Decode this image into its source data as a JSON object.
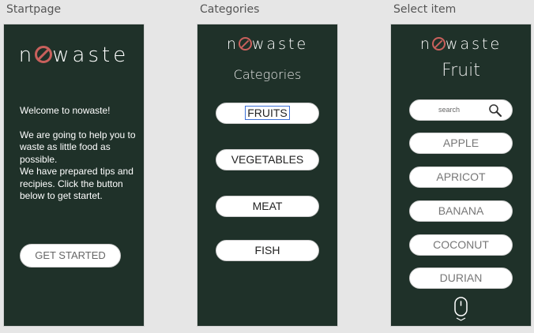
{
  "frames": {
    "start": {
      "label": "Startpage",
      "logo": {
        "pre": "n",
        "post": "waste"
      },
      "welcome_line": "Welcome to nowaste!",
      "help_text": "We are going to help you to waste as little food as possible.",
      "prepared_text": "We have prepared tips and recipies. Click the button below to get startet.",
      "get_started_label": "GET STARTED"
    },
    "categories": {
      "label": "Categories",
      "logo": {
        "pre": "n",
        "post": "waste"
      },
      "heading": "Categories",
      "buttons": [
        "FRUITS",
        "VEGETABLES",
        "MEAT",
        "FISH"
      ],
      "selected": "FRUITS"
    },
    "select_item": {
      "label": "Select item",
      "logo": {
        "pre": "n",
        "post": "waste"
      },
      "heading": "Fruit",
      "search_placeholder": "search",
      "items": [
        "APPLE",
        "APRICOT",
        "BANANA",
        "COCONUT",
        "DURIAN"
      ],
      "scroll_icon": "mouse-scroll-icon"
    }
  },
  "colors": {
    "panel": "#1f3129",
    "logo_accent": "#c9605c",
    "selection_outline": "#3b6fd6"
  }
}
